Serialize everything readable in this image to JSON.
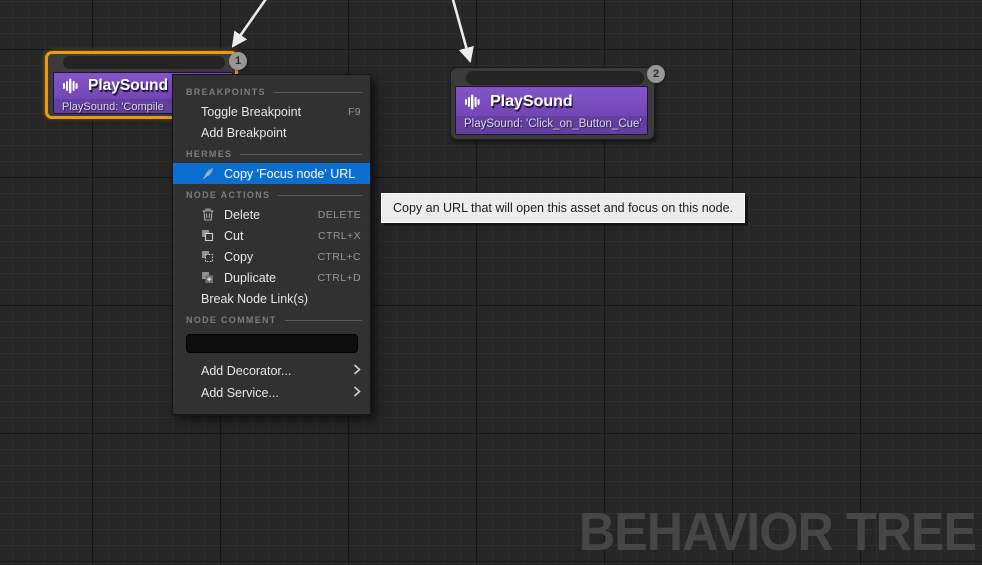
{
  "watermark": "BEHAVIOR TREE",
  "colors": {
    "canvas_bg": "#262626",
    "highlight_blue": "#0b6fd2",
    "selection_orange": "#e89b16",
    "node_purple": "#7a4cc0",
    "tooltip_bg": "#ececec"
  },
  "nodes": [
    {
      "title": "PlaySound",
      "subtitle": "PlaySound: 'Compile",
      "badge": "1",
      "selected": true
    },
    {
      "title": "PlaySound",
      "subtitle": "PlaySound: 'Click_on_Button_Cue'",
      "badge": "2",
      "selected": false
    }
  ],
  "menu": {
    "headers": {
      "breakpoints": "BREAKPOINTS",
      "hermes": "HERMES",
      "node_actions": "NODE ACTIONS",
      "node_comment": "NODE COMMENT"
    },
    "items": {
      "toggle_breakpoint": {
        "label": "Toggle Breakpoint",
        "shortcut": "F9"
      },
      "add_breakpoint": {
        "label": "Add Breakpoint"
      },
      "copy_focus_node_url": {
        "label": "Copy 'Focus node' URL"
      },
      "delete": {
        "label": "Delete",
        "shortcut": "DELETE"
      },
      "cut": {
        "label": "Cut",
        "shortcut": "CTRL+X"
      },
      "copy": {
        "label": "Copy",
        "shortcut": "CTRL+C"
      },
      "duplicate": {
        "label": "Duplicate",
        "shortcut": "CTRL+D"
      },
      "break_node_links": {
        "label": "Break Node Link(s)"
      },
      "add_decorator": {
        "label": "Add Decorator..."
      },
      "add_service": {
        "label": "Add Service..."
      }
    },
    "comment_value": ""
  },
  "tooltip": {
    "text": "Copy an URL that will open this asset and focus on this node."
  }
}
